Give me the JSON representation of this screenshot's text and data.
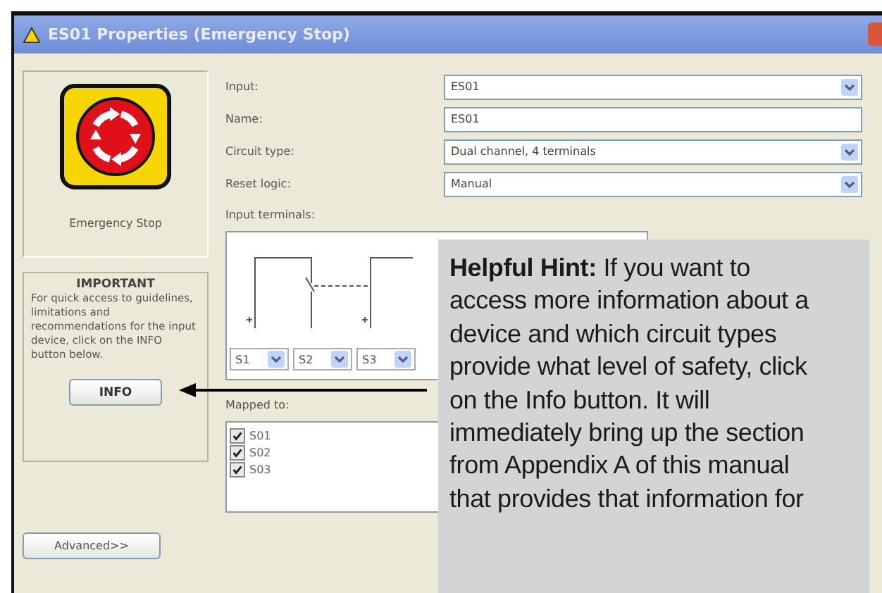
{
  "window": {
    "title": "ES01 Properties (Emergency Stop)"
  },
  "device": {
    "caption": "Emergency Stop"
  },
  "important": {
    "heading": "IMPORTANT",
    "text": "For quick access to guidelines, limitations and recommendations for the input device, click on the INFO button below.",
    "button": "INFO"
  },
  "advanced_button": "Advanced>>",
  "fields": [
    {
      "label": "Input:",
      "value": "ES01",
      "kind": "dropdown"
    },
    {
      "label": "Name:",
      "value": "ES01",
      "kind": "text"
    },
    {
      "label": "Circuit type:",
      "value": "Dual channel, 4 terminals",
      "kind": "dropdown"
    },
    {
      "label": "Reset logic:",
      "value": "Manual",
      "kind": "dropdown"
    }
  ],
  "input_terminals": {
    "label": "Input terminals:",
    "terminals": [
      "S1",
      "S2",
      "S3"
    ]
  },
  "mapped_to": {
    "label": "Mapped to:",
    "items": [
      {
        "label": "S01",
        "checked": true
      },
      {
        "label": "S02",
        "checked": true
      },
      {
        "label": "S03",
        "checked": true
      }
    ]
  },
  "hint": {
    "text": "**Helpful Hint:** If you want to access more information about a device and which circuit types provide what level of safety, click on the Info button. It will immediately bring up the section from Appendix A of this manual that provides that information for"
  }
}
